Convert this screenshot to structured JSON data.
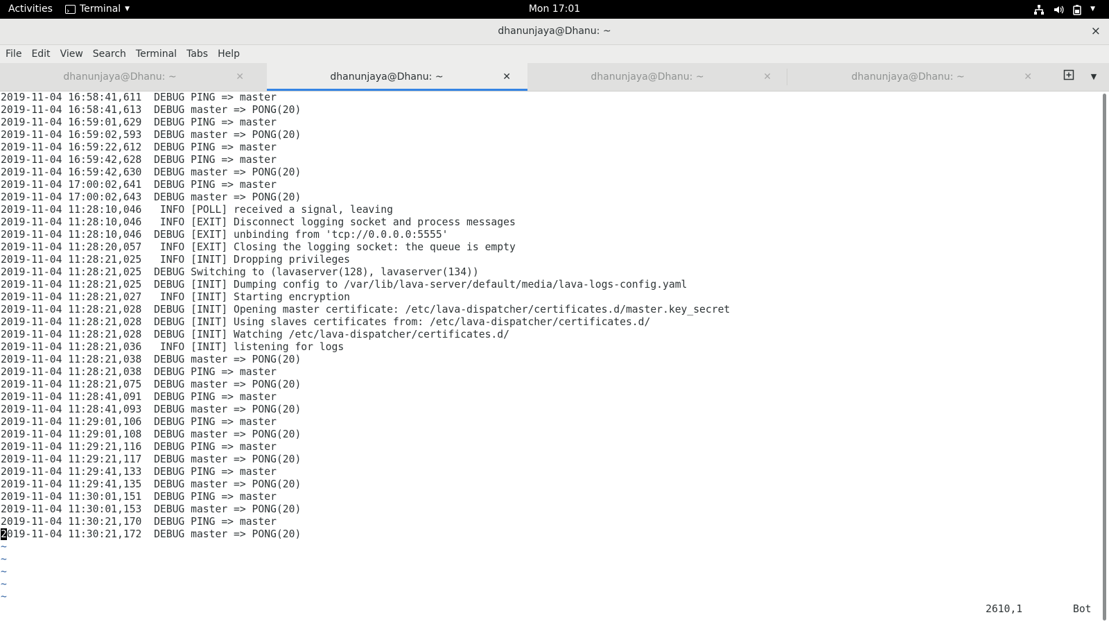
{
  "topbar": {
    "activities": "Activities",
    "app_name": "Terminal",
    "clock": "Mon 17:01",
    "icons": [
      "network-icon",
      "volume-icon",
      "battery-icon"
    ]
  },
  "window": {
    "title": "dhanunjaya@Dhanu: ~",
    "close_glyph": "×"
  },
  "menu": [
    "File",
    "Edit",
    "View",
    "Search",
    "Terminal",
    "Tabs",
    "Help"
  ],
  "tabs": [
    {
      "label": "dhanunjaya@Dhanu: ~",
      "active": false
    },
    {
      "label": "dhanunjaya@Dhanu: ~",
      "active": true
    },
    {
      "label": "dhanunjaya@Dhanu: ~",
      "active": false
    },
    {
      "label": "dhanunjaya@Dhanu: ~",
      "active": false
    }
  ],
  "terminal": {
    "lines": [
      "2019-11-04 16:58:41,611  DEBUG PING => master",
      "2019-11-04 16:58:41,613  DEBUG master => PONG(20)",
      "2019-11-04 16:59:01,629  DEBUG PING => master",
      "2019-11-04 16:59:02,593  DEBUG master => PONG(20)",
      "2019-11-04 16:59:22,612  DEBUG PING => master",
      "2019-11-04 16:59:42,628  DEBUG PING => master",
      "2019-11-04 16:59:42,630  DEBUG master => PONG(20)",
      "2019-11-04 17:00:02,641  DEBUG PING => master",
      "2019-11-04 17:00:02,643  DEBUG master => PONG(20)",
      "2019-11-04 11:28:10,046   INFO [POLL] received a signal, leaving",
      "2019-11-04 11:28:10,046   INFO [EXIT] Disconnect logging socket and process messages",
      "2019-11-04 11:28:10,046  DEBUG [EXIT] unbinding from 'tcp://0.0.0.0:5555'",
      "2019-11-04 11:28:20,057   INFO [EXIT] Closing the logging socket: the queue is empty",
      "2019-11-04 11:28:21,025   INFO [INIT] Dropping privileges",
      "2019-11-04 11:28:21,025  DEBUG Switching to (lavaserver(128), lavaserver(134))",
      "2019-11-04 11:28:21,025  DEBUG [INIT] Dumping config to /var/lib/lava-server/default/media/lava-logs-config.yaml",
      "2019-11-04 11:28:21,027   INFO [INIT] Starting encryption",
      "2019-11-04 11:28:21,028  DEBUG [INIT] Opening master certificate: /etc/lava-dispatcher/certificates.d/master.key_secret",
      "2019-11-04 11:28:21,028  DEBUG [INIT] Using slaves certificates from: /etc/lava-dispatcher/certificates.d/",
      "2019-11-04 11:28:21,028  DEBUG [INIT] Watching /etc/lava-dispatcher/certificates.d/",
      "2019-11-04 11:28:21,036   INFO [INIT] listening for logs",
      "2019-11-04 11:28:21,038  DEBUG master => PONG(20)",
      "2019-11-04 11:28:21,038  DEBUG PING => master",
      "2019-11-04 11:28:21,075  DEBUG master => PONG(20)",
      "2019-11-04 11:28:41,091  DEBUG PING => master",
      "2019-11-04 11:28:41,093  DEBUG master => PONG(20)",
      "2019-11-04 11:29:01,106  DEBUG PING => master",
      "2019-11-04 11:29:01,108  DEBUG master => PONG(20)",
      "2019-11-04 11:29:21,116  DEBUG PING => master",
      "2019-11-04 11:29:21,117  DEBUG master => PONG(20)",
      "2019-11-04 11:29:41,133  DEBUG PING => master",
      "2019-11-04 11:29:41,135  DEBUG master => PONG(20)",
      "2019-11-04 11:30:01,151  DEBUG PING => master",
      "2019-11-04 11:30:01,153  DEBUG master => PONG(20)",
      "2019-11-04 11:30:21,170  DEBUG PING => master"
    ],
    "cursor_line": {
      "cursor_char": "2",
      "rest": "019-11-04 11:30:21,172  DEBUG master => PONG(20)"
    },
    "tildes": [
      "~",
      "~",
      "~",
      "~",
      "~"
    ],
    "status_position": "2610,1",
    "status_scroll": "Bot"
  }
}
